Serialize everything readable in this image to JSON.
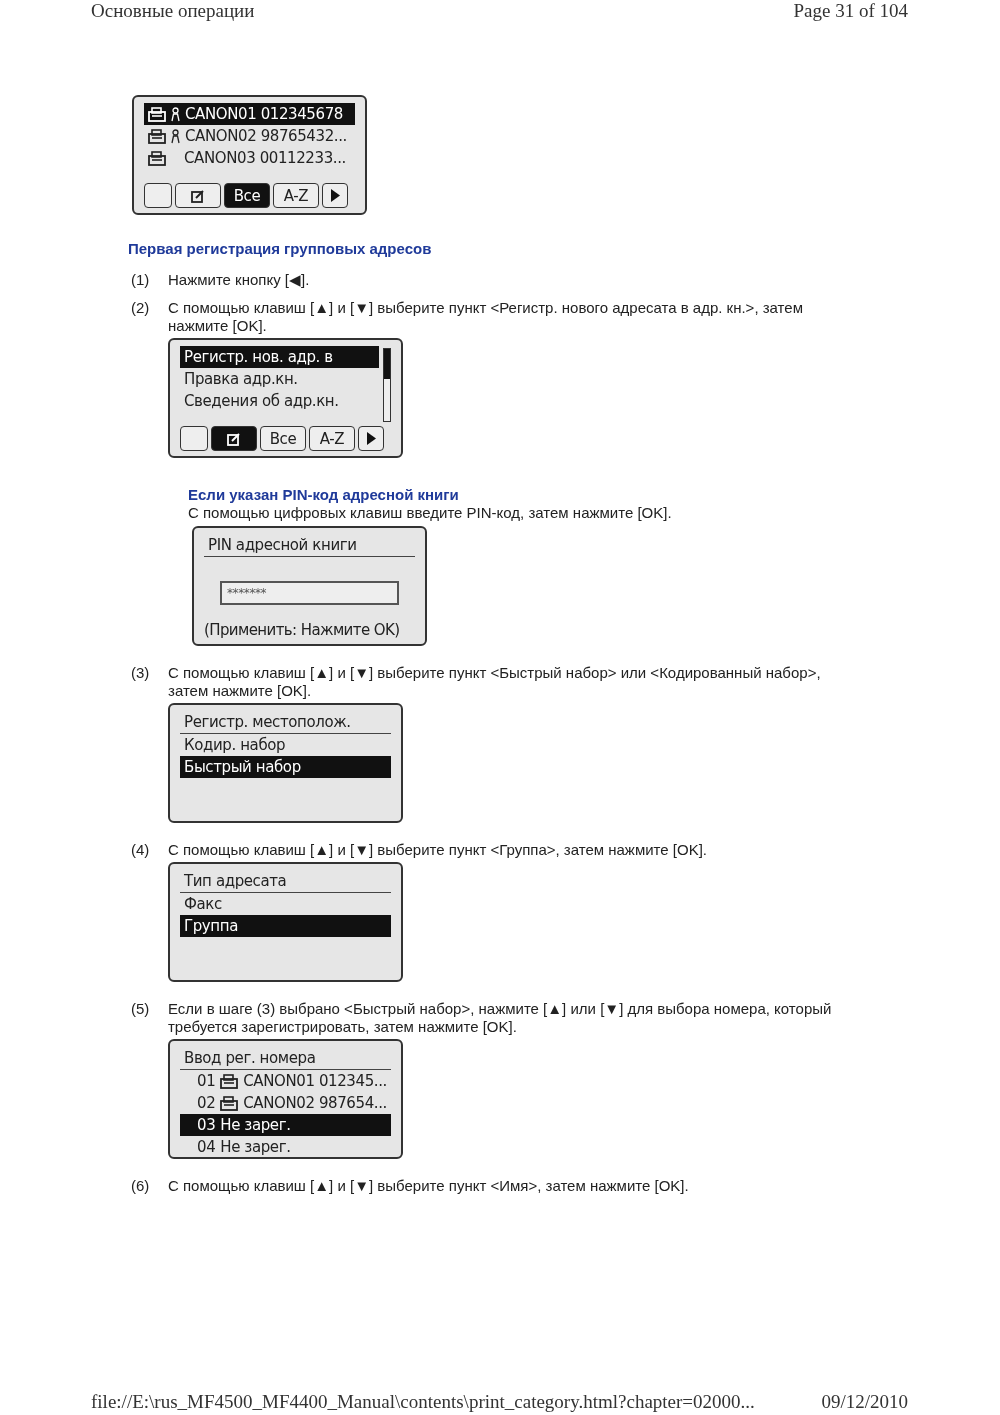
{
  "header": {
    "left": "Основные операции",
    "right": "Page 31 of 104"
  },
  "top_screen": {
    "rows": [
      {
        "kind": "group",
        "text": "CANON01  012345678",
        "selected": true
      },
      {
        "kind": "group",
        "text": "CANON02  98765432...",
        "selected": false
      },
      {
        "kind": "fax",
        "text": "CANON03  00112233...",
        "selected": false
      }
    ],
    "buttons": [
      {
        "kind": "blank",
        "selected": false
      },
      {
        "kind": "edit",
        "selected": false
      },
      {
        "kind": "label",
        "label": "Все",
        "selected": true
      },
      {
        "kind": "label",
        "label": "A-Z",
        "selected": false
      },
      {
        "kind": "next",
        "selected": false
      }
    ]
  },
  "heading": "Первая регистрация групповых адресов",
  "steps": [
    {
      "number": "(1)",
      "text": "Нажмите кнопку [◀]."
    },
    {
      "number": "(2)",
      "text": "С помощью клавиш [▲] и [▼] выберите пункт <Регистр. нового адресата в адр. кн.>, затем нажмите [OK].",
      "children": [
        {
          "kind": "screen",
          "scrollbar": true,
          "rows": [
            {
              "kind": "plain",
              "text": "Регистр. нов. адр. в",
              "selected": true
            },
            {
              "kind": "plain",
              "text": "Правка адр.кн.",
              "selected": false
            },
            {
              "kind": "plain",
              "text": "Сведения об адр.кн.",
              "selected": false
            }
          ],
          "buttons": [
            {
              "kind": "blank",
              "selected": false
            },
            {
              "kind": "edit",
              "selected": true
            },
            {
              "kind": "label",
              "label": "Все",
              "selected": false
            },
            {
              "kind": "label",
              "label": "A-Z",
              "selected": false
            },
            {
              "kind": "next",
              "selected": false
            }
          ]
        },
        {
          "kind": "note",
          "title": "Если указан PIN-код адресной книги",
          "text": "С помощью цифровых клавиш введите PIN-код, затем нажмите [OK].",
          "screen": {
            "title": "PIN адресной книги",
            "field": "*******",
            "footer": "(Применить: Нажмите OK)"
          }
        }
      ]
    },
    {
      "number": "(3)",
      "text": "С помощью клавиш [▲] и [▼] выберите пункт <Быстрый набор> или <Кодированный набор>, затем нажмите [OK].",
      "children": [
        {
          "kind": "screen",
          "title": "Регистр. местополож.",
          "rows": [
            {
              "kind": "plain",
              "text": "Кодир. набор",
              "selected": false
            },
            {
              "kind": "plain",
              "text": "Быстрый набор",
              "selected": true
            }
          ]
        }
      ]
    },
    {
      "number": "(4)",
      "text": "С помощью клавиш [▲] и [▼] выберите пункт <Группа>, затем нажмите [OK].",
      "children": [
        {
          "kind": "screen",
          "title": "Тип адресата",
          "rows": [
            {
              "kind": "plain",
              "text": "Факс",
              "selected": false
            },
            {
              "kind": "plain",
              "text": "Группа",
              "selected": true
            }
          ]
        }
      ]
    },
    {
      "number": "(5)",
      "text": "Если в шаге (3) выбрано <Быстрый набор>, нажмите [▲] или [▼] для выбора номера, который требуется зарегистрировать, затем нажмите [OK].",
      "children": [
        {
          "kind": "screen",
          "title": "Ввод рег. номера",
          "rows": [
            {
              "kind": "numbered-fax",
              "number": "01",
              "text": "CANON01  012345...",
              "selected": false
            },
            {
              "kind": "numbered-fax",
              "number": "02",
              "text": "CANON02  987654...",
              "selected": false
            },
            {
              "kind": "numbered",
              "number": "03",
              "text": "Не зарег.",
              "selected": true
            },
            {
              "kind": "numbered",
              "number": "04",
              "text": "Не зарег.",
              "selected": false
            }
          ]
        }
      ]
    },
    {
      "number": "(6)",
      "text": "С помощью клавиш [▲] и [▼] выберите пункт <Имя>, затем нажмите [OK]."
    }
  ],
  "footer": {
    "left": "file://E:\\rus_MF4500_MF4400_Manual\\contents\\print_category.html?chapter=02000...",
    "right": "09/12/2010"
  }
}
